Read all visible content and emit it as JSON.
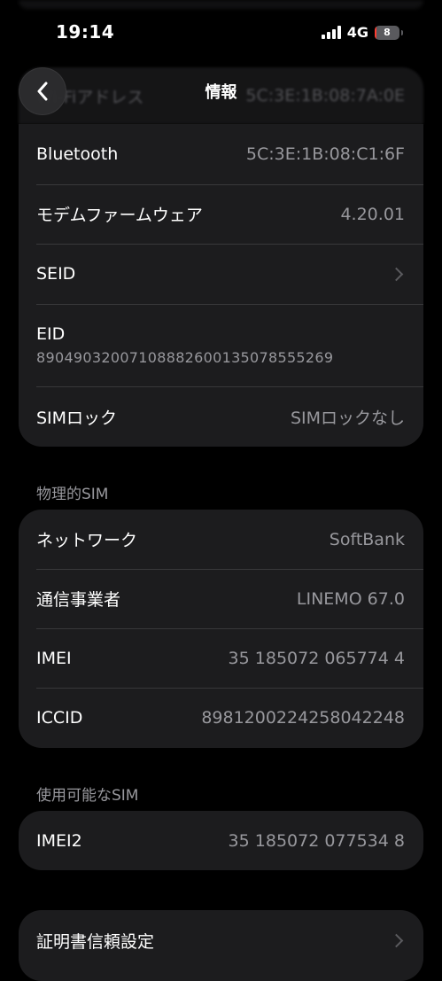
{
  "status_bar": {
    "time": "19:14",
    "network": "4G",
    "battery_level": "8",
    "battery_fraction": 0.08,
    "signal_icon": "signal-bars-icon",
    "battery_icon": "battery-icon"
  },
  "nav": {
    "title": "情報",
    "back_icon": "chevron-left-icon"
  },
  "partial_row": {
    "label": "Wi-Fiアドレス",
    "value": "5C:3E:1B:08:7A:0E"
  },
  "card1": {
    "rows": [
      {
        "label": "Bluetooth",
        "value": "5C:3E:1B:08:C1:6F"
      },
      {
        "label": "モデムファームウェア",
        "value": "4.20.01"
      },
      {
        "label": "SEID",
        "value": ""
      },
      {
        "label": "EID",
        "value": "89049032007108882600135078555269"
      },
      {
        "label": "SIMロック",
        "value": "SIMロックなし"
      }
    ]
  },
  "section_physical": {
    "header": "物理的SIM",
    "rows": [
      {
        "label": "ネットワーク",
        "value": "SoftBank"
      },
      {
        "label": "通信事業者",
        "value": "LINEMO 67.0"
      },
      {
        "label": "IMEI",
        "value": "35 185072 065774 4"
      },
      {
        "label": "ICCID",
        "value": "8981200224258042248"
      }
    ]
  },
  "section_available": {
    "header": "使用可能なSIM",
    "rows": [
      {
        "label": "IMEI2",
        "value": "35 185072 077534 8"
      }
    ]
  },
  "card_cert": {
    "label": "証明書信頼設定"
  },
  "colors": {
    "background": "#000000",
    "card": "#1c1c1e",
    "separator": "#38383a",
    "secondary_text": "#98989d",
    "battery_low": "#ff3b30"
  }
}
